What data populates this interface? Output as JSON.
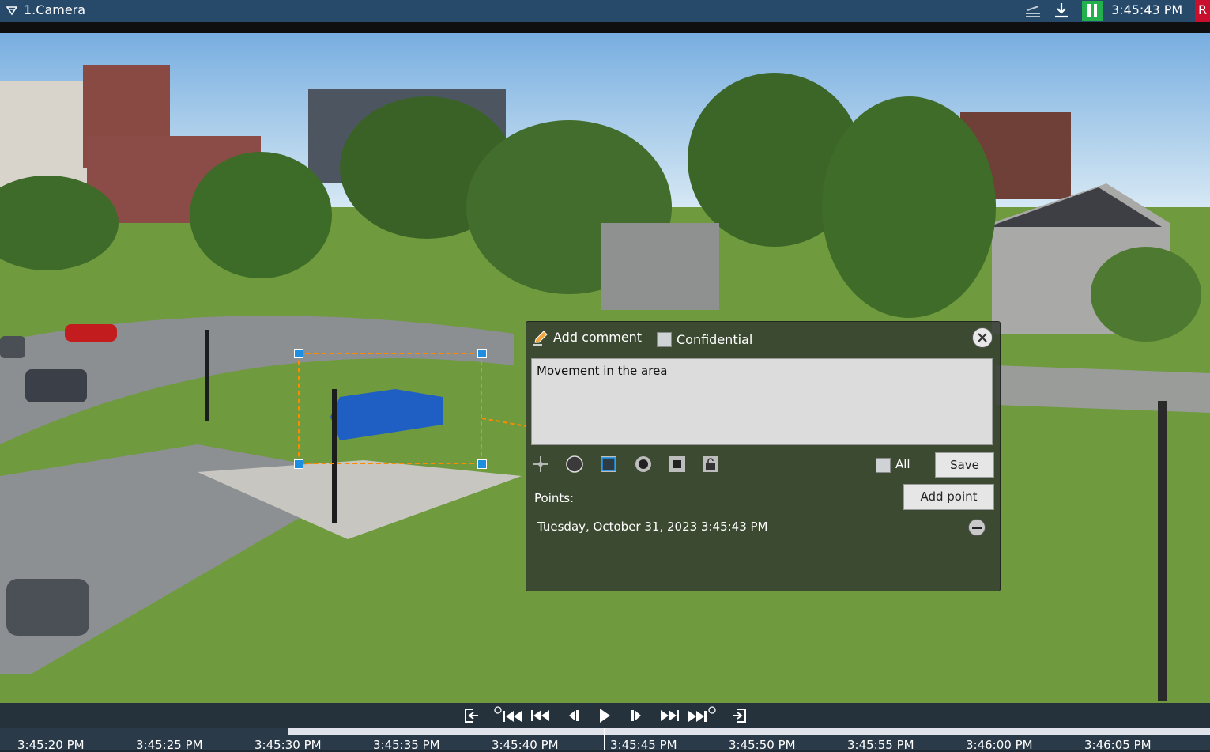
{
  "header": {
    "camera_name": "1.Camera",
    "time": "3:45:43 PM",
    "rec_badge": "R",
    "icons": [
      "menu-triangle-icon",
      "layers-icon",
      "download-icon",
      "pause-icon"
    ]
  },
  "comment_panel": {
    "title": "Add comment",
    "confidential_label": "Confidential",
    "confidential_checked": false,
    "comment_text": "Movement in the area",
    "tools": [
      "crosshair-icon",
      "circle-outline-icon",
      "square-outline-icon",
      "circle-filled-icon",
      "square-filled-icon",
      "lock-icon"
    ],
    "selected_tool": "square-outline-icon",
    "all_label": "All",
    "all_checked": false,
    "save_label": "Save",
    "points_label": "Points:",
    "add_point_label": "Add point",
    "points": [
      "Tuesday, October 31, 2023 3:45:43 PM"
    ]
  },
  "playback": {
    "buttons": [
      "go-start-icon",
      "prev-event-icon",
      "rewind-icon",
      "step-back-icon",
      "play-icon",
      "step-forward-icon",
      "fast-forward-icon",
      "next-event-icon",
      "go-end-icon"
    ]
  },
  "timeline": {
    "ticks": [
      "3:45:20 PM",
      "3:45:25 PM",
      "3:45:30 PM",
      "3:45:35 PM",
      "3:45:40 PM",
      "3:45:45 PM",
      "3:45:50 PM",
      "3:45:55 PM",
      "3:46:00 PM",
      "3:46:05 PM"
    ]
  },
  "colors": {
    "header_bg": "#274a6b",
    "pause_green": "#22b14c",
    "rec_red": "#c8102e",
    "selection_orange": "#ff8a00",
    "handle_blue": "#1e8fe0"
  }
}
